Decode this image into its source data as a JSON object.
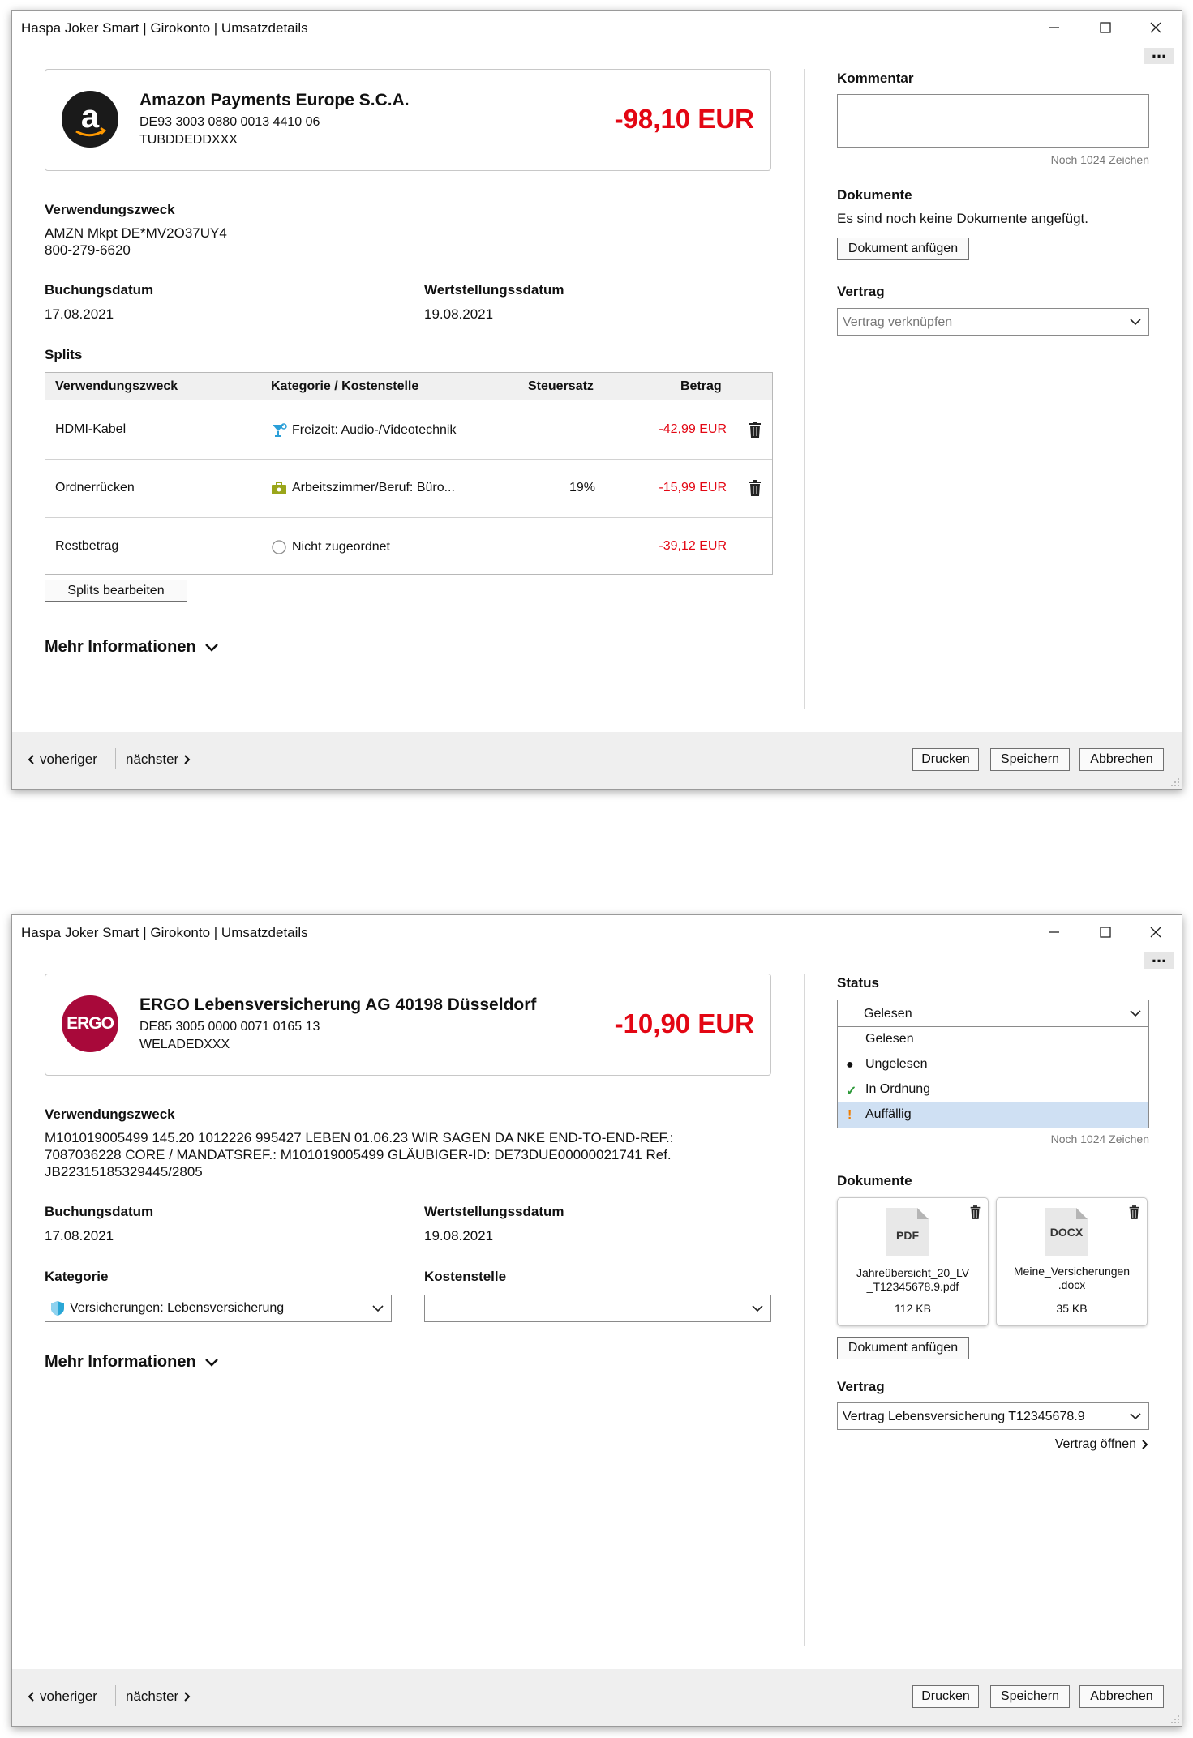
{
  "app_title": "Haspa Joker Smart | Girokonto | Umsatzdetails",
  "window1": {
    "payee": {
      "name": "Amazon Payments Europe S.C.A.",
      "iban": "DE93 3003 0880 0013 4410 06",
      "bic": "TUBDDEDDXXX",
      "amount": "-98,10 EUR",
      "logo_icon": "amazon-logo"
    },
    "purpose": {
      "label": "Verwendungszweck",
      "line1": "AMZN Mkpt DE*MV2O37UY4",
      "line2": "800-279-6620"
    },
    "booking_date": {
      "label": "Buchungsdatum",
      "value": "17.08.2021"
    },
    "value_date": {
      "label": "Wertstellungssdatum",
      "value": "19.08.2021"
    },
    "splits": {
      "label": "Splits",
      "columns": [
        "Verwendungszweck",
        "Kategorie / Kostenstelle",
        "Steuersatz",
        "Betrag"
      ],
      "rows": [
        {
          "purpose": "HDMI-Kabel",
          "category": "Freizeit: Audio-/Videotechnik",
          "category_icon": "cocktail-icon",
          "tax": "",
          "amount": "-42,99 EUR",
          "deletable": true
        },
        {
          "purpose": "Ordnerrücken",
          "category": "Arbeitszimmer/Beruf: Büro...",
          "category_icon": "briefcase-icon",
          "tax": "19%",
          "amount": "-15,99 EUR",
          "deletable": true
        },
        {
          "purpose": "Restbetrag",
          "category": "Nicht zugeordnet",
          "category_icon": "empty-circle-icon",
          "tax": "",
          "amount": "-39,12 EUR",
          "deletable": false
        }
      ],
      "edit_button": "Splits bearbeiten"
    },
    "more_info": "Mehr Informationen",
    "comment": {
      "label": "Kommentar",
      "value": "",
      "hint": "Noch 1024 Zeichen"
    },
    "documents": {
      "label": "Dokumente",
      "empty_text": "Es sind noch keine Dokumente angefügt.",
      "attach_button": "Dokument anfügen"
    },
    "contract": {
      "label": "Vertrag",
      "placeholder": "Vertrag verknüpfen"
    }
  },
  "window2": {
    "payee": {
      "name": "ERGO Lebensversicherung AG 40198 Düsseldorf",
      "iban": "DE85 3005 0000 0071 0165 13",
      "bic": "WELADEDXXX",
      "amount": "-10,90 EUR",
      "logo_text": "ERGO"
    },
    "purpose": {
      "label": "Verwendungszweck",
      "line1": "M101019005499 145.20 1012226 995427 LEBEN 01.06.23 WIR SAGEN DA NKE END-TO-END-REF.:",
      "line2": "7087036228 CORE / MANDATSREF.: M101019005499 GLÄUBIGER-ID: DE73DUE00000021741 Ref.",
      "line3": "JB22315185329445/2805"
    },
    "booking_date": {
      "label": "Buchungsdatum",
      "value": "17.08.2021"
    },
    "value_date": {
      "label": "Wertstellungssdatum",
      "value": "19.08.2021"
    },
    "category": {
      "label": "Kategorie",
      "value": "Versicherungen: Lebensversicherung",
      "icon": "shield-icon"
    },
    "cost_center": {
      "label": "Kostenstelle",
      "value": ""
    },
    "more_info": "Mehr Informationen",
    "status": {
      "label": "Status",
      "selected": "Gelesen",
      "options": [
        {
          "label": "Gelesen",
          "marker": "",
          "marker_icon": "none"
        },
        {
          "label": "Ungelesen",
          "marker": "●",
          "marker_icon": "dot-icon"
        },
        {
          "label": "In Ordnung",
          "marker": "✓",
          "marker_icon": "check-icon"
        },
        {
          "label": "Auffällig",
          "marker": "!",
          "marker_icon": "exclamation-icon"
        }
      ],
      "highlighted": "Auffällig"
    },
    "comment_hint": "Noch 1024 Zeichen",
    "documents": {
      "label": "Dokumente",
      "files": [
        {
          "type": "PDF",
          "name_line1": "Jahreübersicht_20_LV",
          "name_line2": "_T12345678.9.pdf",
          "size": "112 KB"
        },
        {
          "type": "DOCX",
          "name_line1": "Meine_Versicherungen",
          "name_line2": ".docx",
          "size": "35 KB"
        }
      ],
      "attach_button": "Dokument anfügen"
    },
    "contract": {
      "label": "Vertrag",
      "value": "Vertrag Lebensversicherung T12345678.9",
      "open_link": "Vertrag öffnen"
    }
  },
  "footer": {
    "prev": "voheriger",
    "next": "nächster",
    "print": "Drucken",
    "save": "Speichern",
    "cancel": "Abbrechen"
  },
  "colors": {
    "negative_amount": "#e30613",
    "ergo_red": "#a8093a",
    "highlight": "#cfe0f3",
    "check_green": "#2e9a3a",
    "alert_orange": "#f07d00"
  }
}
